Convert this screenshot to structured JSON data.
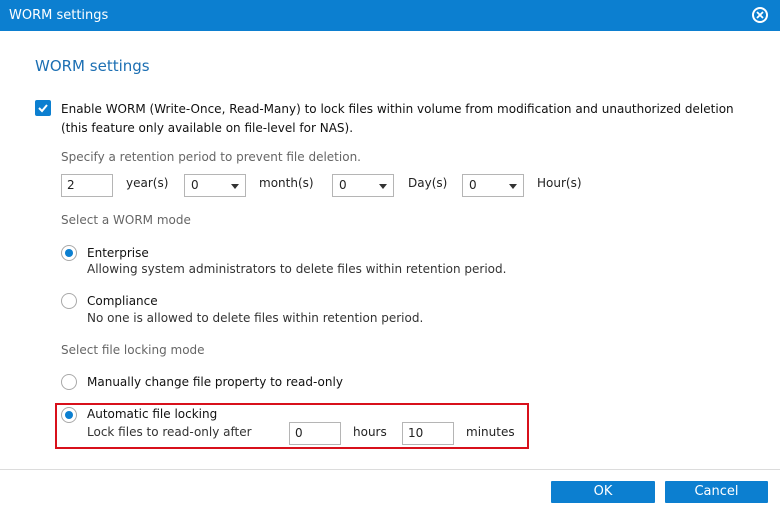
{
  "window": {
    "title": "WORM settings"
  },
  "heading": "WORM settings",
  "enable": {
    "checked": true,
    "text": "Enable WORM (Write-Once, Read-Many) to lock files within volume from modification and unauthorized deletion (this feature only available on file-level for NAS)."
  },
  "retention": {
    "label": "Specify a retention period to prevent file deletion.",
    "years_value": "2",
    "years_unit": "year(s)",
    "months_value": "0",
    "months_unit": "month(s)",
    "days_value": "0",
    "days_unit": "Day(s)",
    "hours_value": "0",
    "hours_unit": "Hour(s)"
  },
  "worm_mode": {
    "label": "Select a WORM mode",
    "options": [
      {
        "title": "Enterprise",
        "desc": "Allowing system administrators to delete files within retention period.",
        "selected": true
      },
      {
        "title": "Compliance",
        "desc": "No one is allowed to delete files within retention period.",
        "selected": false
      }
    ]
  },
  "locking_mode": {
    "label": "Select file locking mode",
    "manual": {
      "title": "Manually change file property to read-only",
      "selected": false
    },
    "automatic": {
      "title": "Automatic file locking",
      "selected": true,
      "prefix": "Lock files to read-only after",
      "hours_value": "0",
      "hours_unit": "hours",
      "minutes_value": "10",
      "minutes_unit": "minutes"
    }
  },
  "buttons": {
    "ok": "OK",
    "cancel": "Cancel"
  },
  "colors": {
    "accent": "#0c7fd0",
    "heading": "#1c6fb3",
    "highlight": "#d8101b"
  },
  "icons": {
    "close": "close-circle-icon",
    "check": "checkmark-icon",
    "dropdown": "chevron-down-icon"
  }
}
